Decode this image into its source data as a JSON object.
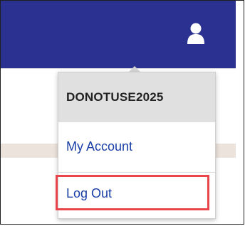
{
  "header": {
    "user_icon": "user-icon"
  },
  "dropdown": {
    "username": "DONOTUSE2025",
    "items": [
      {
        "label": "My Account"
      },
      {
        "label": "Log Out"
      }
    ]
  },
  "colors": {
    "topbar": "#2b3191",
    "link": "#1a3fa6",
    "header_bg": "#e0e0e0",
    "highlight": "#e8464a",
    "band": "#ece4dc"
  }
}
